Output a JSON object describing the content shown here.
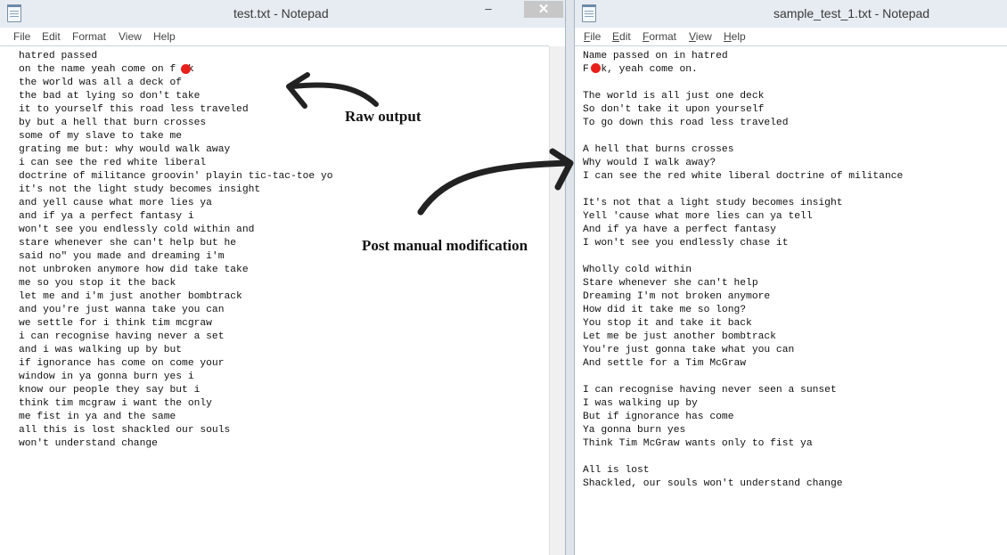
{
  "left_window": {
    "title": "test.txt - Notepad",
    "icon": "notepad-icon",
    "minimize_glyph": "–",
    "close_glyph": "✕",
    "menu": [
      "File",
      "Edit",
      "Format",
      "View",
      "Help"
    ],
    "content": "hatred passed\non the name yeah come on f  k\nthe world was all a deck of\nthe bad at lying so don't take\nit to yourself this road less traveled\nby but a hell that burn crosses\nsome of my slave to take me\ngrating me but: why would walk away\ni can see the red white liberal\ndoctrine of militance groovin' playin tic-tac-toe yo\nit's not the light study becomes insight\nand yell cause what more lies ya\nand if ya a perfect fantasy i\nwon't see you endlessly cold within and\nstare whenever she can't help but he\nsaid no\" you made and dreaming i'm\nnot unbroken anymore how did take take\nme so you stop it the back\nlet me and i'm just another bombtrack\nand you're just wanna take you can\nwe settle for i think tim mcgraw\ni can recognise having never a set\nand i was walking up by but\nif ignorance has come on come your\nwindow in ya gonna burn yes i\nknow our people they say but i\nthink tim mcgraw i want the only\nme fist in ya and the same\nall this is lost shackled our souls\nwon't understand change"
  },
  "right_window": {
    "title": "sample_test_1.txt - Notepad",
    "icon": "notepad-icon",
    "menu": [
      {
        "u": "F",
        "rest": "ile"
      },
      {
        "u": "E",
        "rest": "dit"
      },
      {
        "u": "F",
        "rest": "ormat"
      },
      {
        "u": "V",
        "rest": "iew"
      },
      {
        "u": "H",
        "rest": "elp"
      }
    ],
    "content": "Name passed on in hatred\nF  k, yeah come on.\n\nThe world is all just one deck\nSo don't take it upon yourself\nTo go down this road less traveled\n\nA hell that burns crosses\nWhy would I walk away?\nI can see the red white liberal doctrine of militance\n\nIt's not that a light study becomes insight\nYell 'cause what more lies can ya tell\nAnd if ya have a perfect fantasy\nI won't see you endlessly chase it\n\nWholly cold within\nStare whenever she can't help\nDreaming I'm not broken anymore\nHow did it take me so long?\nYou stop it and take it back\nLet me be just another bombtrack\nYou're just gonna take what you can\nAnd settle for a Tim McGraw\n\nI can recognise having never seen a sunset\nI was walking up by\nBut if ignorance has come\nYa gonna burn yes\nThink Tim McGraw wants only to fist ya\n\nAll is lost\nShackled, our souls won't understand change"
  },
  "annotations": {
    "raw_output": "Raw output",
    "post_modification": "Post manual modification"
  },
  "colors": {
    "censor_mark": "#e8201c",
    "close_button": "#c7c7c7",
    "titlebar": "#e7ecf2",
    "arrow": "#222222"
  }
}
